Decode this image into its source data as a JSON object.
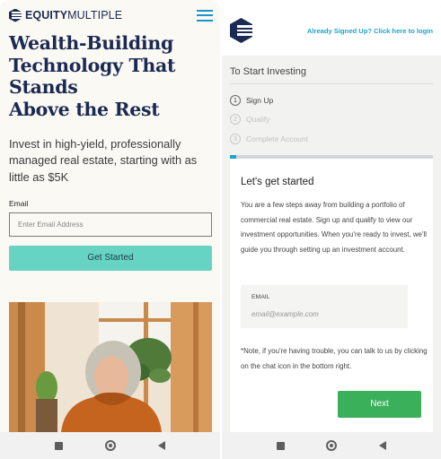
{
  "left_phone": {
    "brand": {
      "logo_bold": "EQUITY",
      "logo_regular": "MULTIPLE",
      "color": "#1b2a52"
    },
    "hero_lines": [
      "Wealth-Building",
      "Technology That",
      "Stands",
      "Above the Rest"
    ],
    "subheading": "Invest in high-yield, professionally managed real estate, starting with as little as $5K",
    "email": {
      "label": "Email",
      "placeholder": "Enter Email Address"
    },
    "cta": {
      "label": "Get Started",
      "color": "#67d3c3"
    },
    "icons": [
      "equitymultiple-logo-icon",
      "hamburger-menu-icon"
    ]
  },
  "right_phone": {
    "header": {
      "login_link": "Already Signed Up? Click here to login"
    },
    "section_title": "To Start Investing",
    "steps": [
      {
        "number": "1",
        "label": "Sign Up",
        "active": true
      },
      {
        "number": "2",
        "label": "Qualify",
        "active": false
      },
      {
        "number": "3",
        "label": "Complete Account",
        "active": false
      }
    ],
    "progress": 0.03,
    "card": {
      "title": "Let's get started",
      "body": "You are a few steps away from building a portfolio of commercial real estate. Sign up and qualify to view our investment opportunities. When you're ready to invest, we'll guide you through setting up an investment account.",
      "email_label": "EMAIL",
      "email_placeholder": "email@example.com",
      "note": "*Note, if you're having trouble, you can talk to us by clicking on the chat icon in the bottom right.",
      "next_label": "Next"
    },
    "accent_color": "#1ea5c8",
    "next_color": "#3bb05a"
  },
  "system_nav": [
    "recent-apps-icon",
    "home-icon",
    "back-icon"
  ]
}
